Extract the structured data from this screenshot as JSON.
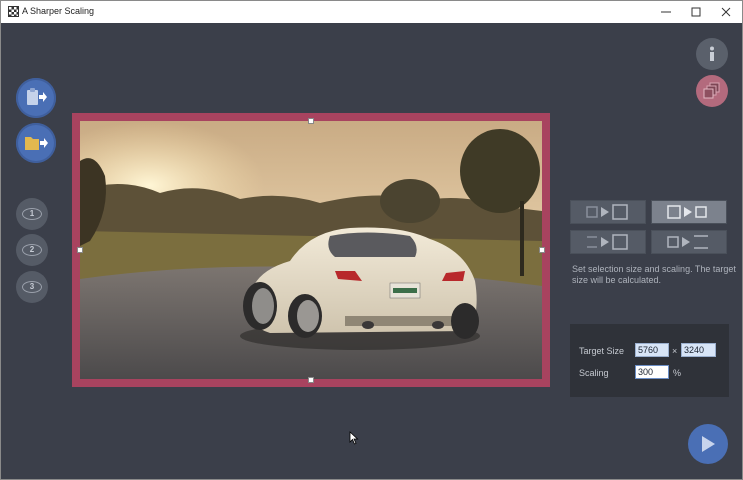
{
  "window": {
    "title": "A Sharper Scaling"
  },
  "left_buttons": [
    {
      "name": "paste-button",
      "icon": "clipboard-arrow-icon"
    },
    {
      "name": "open-folder-button",
      "icon": "folder-arrow-icon"
    }
  ],
  "presets": [
    {
      "label": "1"
    },
    {
      "label": "2"
    },
    {
      "label": "3"
    }
  ],
  "right_top_buttons": [
    {
      "name": "info-button",
      "icon": "info-icon"
    },
    {
      "name": "copy-button",
      "icon": "copy-stack-icon"
    }
  ],
  "hint_text": "Set selection size and scaling. The target size will be calculated.",
  "target_panel": {
    "target_size_label": "Target Size",
    "width_value": "5760",
    "times_sign": "×",
    "height_value": "3240",
    "scaling_label": "Scaling",
    "scaling_value": "300",
    "percent_sign": "%"
  },
  "colors": {
    "background": "#3b3f4a",
    "accent_blue": "#4a6fb5",
    "frame": "#a8435f"
  }
}
